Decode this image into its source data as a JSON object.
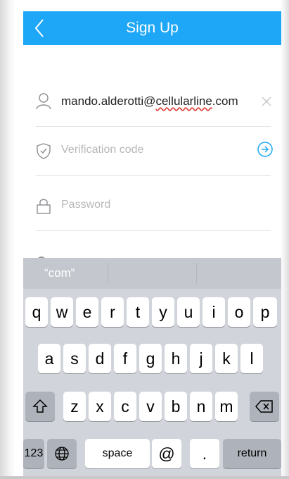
{
  "navbar": {
    "title": "Sign Up"
  },
  "form": {
    "email_value": "mando.alderotti@cellularline.com",
    "email_value_prefix": "mando.alderotti@",
    "email_value_misspelled": "cellularline",
    "email_value_suffix": ".com",
    "code_placeholder": "Verification code",
    "password_placeholder": "Password"
  },
  "keyboard": {
    "suggestion": "“com”",
    "row1": [
      "q",
      "w",
      "e",
      "r",
      "t",
      "y",
      "u",
      "i",
      "o",
      "p"
    ],
    "row2": [
      "a",
      "s",
      "d",
      "f",
      "g",
      "h",
      "j",
      "k",
      "l"
    ],
    "row3": [
      "z",
      "x",
      "c",
      "v",
      "b",
      "n",
      "m"
    ],
    "numbers_key": "123",
    "space_key": "space",
    "at_key": "@",
    "dot_key": ".",
    "return_key": "return"
  },
  "colors": {
    "accent": "#1ea7f7",
    "keyboard_bg": "#d1d5db"
  }
}
